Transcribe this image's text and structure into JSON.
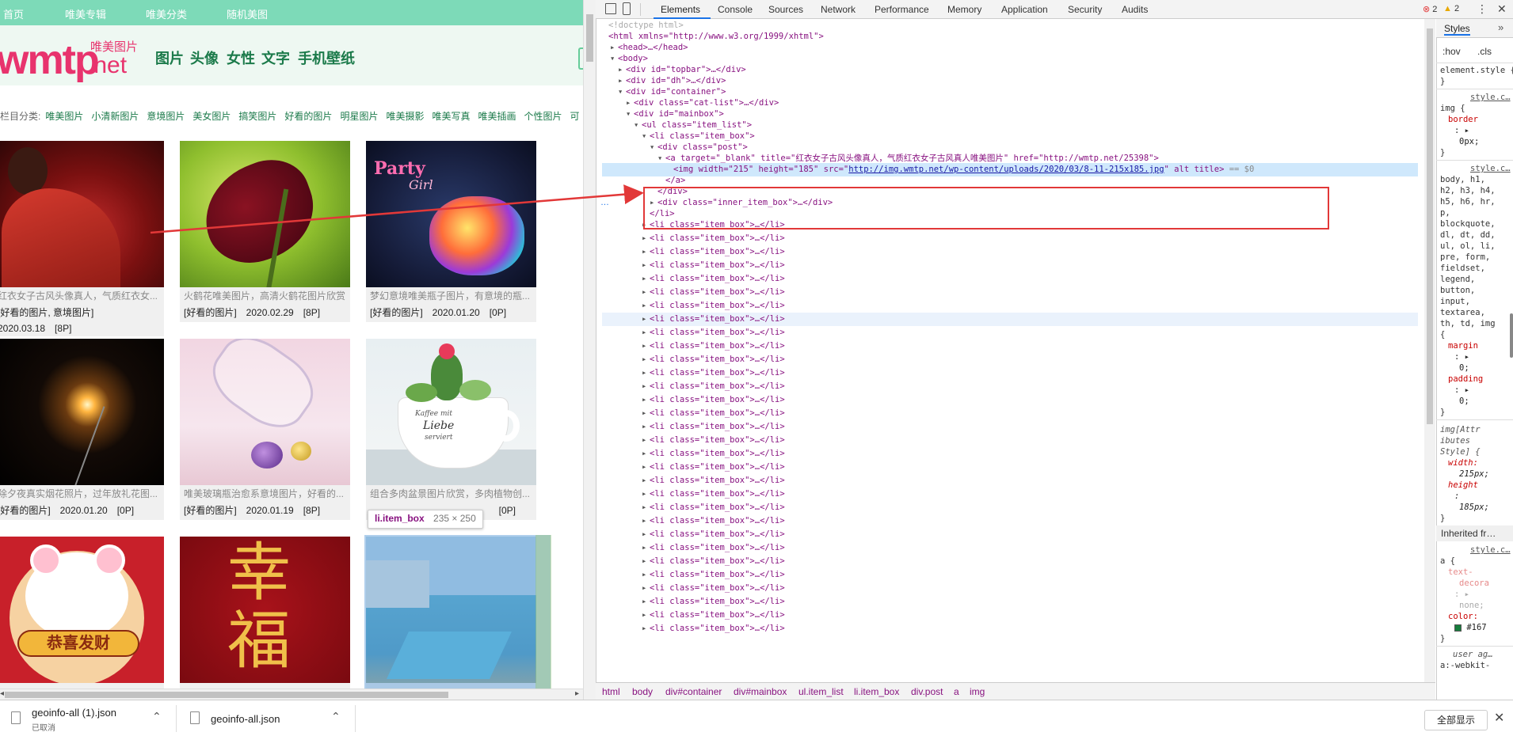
{
  "site": {
    "topnav": [
      "首页",
      "唯美专辑",
      "唯美分类",
      "随机美图"
    ],
    "logo": {
      "main": "wmtp",
      "cn": "唯美图片",
      "tld": ".net"
    },
    "mainnav": [
      "图片",
      "头像",
      "女性",
      "文字",
      "手机壁纸"
    ],
    "category_bar": {
      "prefix": "栏目分类:",
      "items": [
        "唯美图片",
        "小清新图片",
        "意境图片",
        "美女图片",
        "搞笑图片",
        "好看的图片",
        "明星图片",
        "唯美摄影",
        "唯美写真",
        "唯美插画",
        "个性图片",
        "可"
      ]
    },
    "cards": [
      {
        "caption": "红衣女子古风头像真人，气质红衣女...",
        "meta1": "[好看的图片, 意境图片]",
        "meta2": "2020.03.18　[8P]",
        "theme": "red"
      },
      {
        "caption": "火鹤花唯美图片，高清火鹤花图片欣赏",
        "meta1": "[好看的图片]　2020.02.29　[8P]",
        "meta2": "",
        "theme": "flower"
      },
      {
        "caption": "梦幻意境唯美瓶子图片，有意境的瓶...",
        "meta1": "[好看的图片]　2020.01.20　[0P]",
        "meta2": "",
        "theme": "party"
      },
      {
        "caption": "除夕夜真实烟花照片，过年放礼花图...",
        "meta1": "[好看的图片]　2020.01.20　[0P]",
        "meta2": "",
        "theme": "spark"
      },
      {
        "caption": "唯美玻璃瓶治愈系意境图片，好看的...",
        "meta1": "[好看的图片]　2020.01.19　[8P]",
        "meta2": "",
        "theme": "jar"
      },
      {
        "caption": "组合多肉盆景图片欣赏，多肉植物创...",
        "meta1": "[好看的图片]　",
        "meta2": "",
        "meta1_tail": "[0P]",
        "theme": "cup"
      },
      {
        "caption": "",
        "meta1": "",
        "meta2": "",
        "theme": "mouse"
      },
      {
        "caption": "",
        "meta1": "",
        "meta2": "",
        "theme": "fu"
      },
      {
        "caption": "",
        "meta1": "",
        "meta2": "",
        "theme": "pool"
      }
    ],
    "party_text": "Party",
    "party_sub": "Girl",
    "mouse_text": "恭喜发财",
    "fu_text_1": "幸",
    "fu_text_2": "福",
    "cup_text_1": "Kaffee mit",
    "cup_text_2": "Liebe",
    "cup_text_3": "serviert",
    "tooltip": {
      "name": "li.item_box",
      "size": "235 × 250"
    }
  },
  "devtools": {
    "tabs": [
      "Elements",
      "Console",
      "Sources",
      "Network",
      "Performance",
      "Memory",
      "Application",
      "Security",
      "Audits"
    ],
    "active_tab": "Elements",
    "errors": "2",
    "warnings": "2",
    "dom": {
      "doctype": "<!doctype html>",
      "html_open": "<html xmlns=\"http://www.w3.org/1999/xhtml\">",
      "head": "<head>…</head>",
      "body": "<body>",
      "topbar": "<div id=\"topbar\">…</div>",
      "dh": "<div id=\"dh\">…</div>",
      "container": "<div id=\"container\">",
      "catlist": "<div class=\"cat-list\">…</div>",
      "mainbox": "<div id=\"mainbox\">",
      "ul": "<ul class=\"item_list\">",
      "li_open": "<li class=\"item_box\">",
      "post": "<div class=\"post\">",
      "a_open": "<a target=\"_blank\" title=\"红衣女子古风头像真人，气质红衣女子古风真人唯美图片\" href=\"http://wmtp.net/25398\">",
      "img_pre": "<img width=\"215\" height=\"185\" src=\"",
      "img_src": "http://img.wmtp.net/wp-content/uploads/2020/03/8-11-215x185.jpg",
      "img_post": "\" alt title>",
      "img_eq": " == $0",
      "a_close": "</a>",
      "div_close": "</div>",
      "inner": "<div class=\"inner_item_box\">…</div>",
      "li_close": "</li>",
      "li_collapsed": "<li class=\"item_box\">…</li>"
    },
    "breadcrumb": [
      "html",
      "body",
      "div#container",
      "div#mainbox",
      "ul.item_list",
      "li.item_box",
      "div.post",
      "a",
      "img"
    ],
    "styles": {
      "tabs": [
        "Styles",
        "»"
      ],
      "filter": [
        ":hov",
        ".cls"
      ],
      "element_style": "element.style {",
      "close": "}",
      "src1": "style.c…",
      "rule1_sel": "img {",
      "rule1_prop": "border",
      "rule1_val": "0px;",
      "src2": "style.c…",
      "rule2_sel": [
        "body, h1,",
        "h2, h3, h4,",
        "h5, h6, hr,",
        "p,",
        "blockquote,",
        "dl, dt, dd,",
        "ul, ol, li,",
        "pre, form,",
        "fieldset,",
        "legend,",
        "button,",
        "input,",
        "textarea,",
        "th, td, img",
        "{"
      ],
      "rule2_p1": "margin",
      "rule2_v1": "0;",
      "rule2_p2": "padding",
      "rule2_v2": "0;",
      "rule3_sel": [
        "img[Attr",
        "ibutes",
        "Style] {"
      ],
      "rule3_p1": "width:",
      "rule3_v1": "215px;",
      "rule3_p2": "height",
      "rule3_v2": "185px;",
      "inherited": "Inherited fr…",
      "src3": "style.c…",
      "rule4_sel": "a {",
      "rule4_p1": "text-",
      "rule4_p1b": "decora",
      "rule4_v1": "none;",
      "rule4_p2": "color:",
      "rule4_v2": "#167",
      "ua": "user ag…",
      "ua2": "a:-webkit-"
    }
  },
  "downloads": [
    {
      "name": "geoinfo-all (1).json",
      "status": "已取消"
    },
    {
      "name": "geoinfo-all.json",
      "status": ""
    }
  ],
  "download_bar": {
    "show_all": "全部显示"
  }
}
